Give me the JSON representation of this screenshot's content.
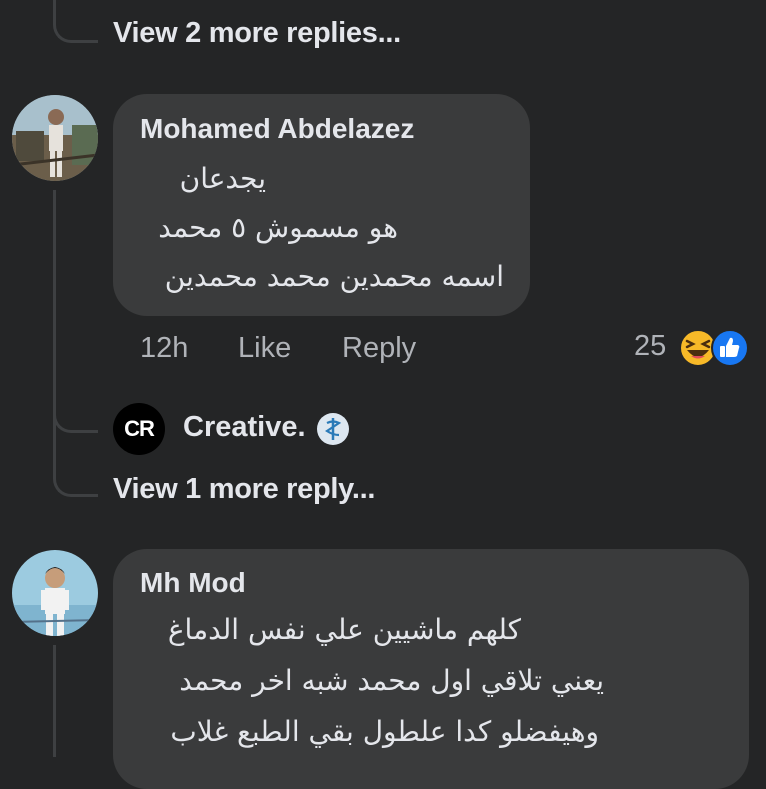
{
  "thread_top": {
    "more_replies": "View 2 more replies..."
  },
  "comment1": {
    "author": "Mohamed Abdelazez",
    "lines": [
      "يجدعان",
      "هو مسموش ٥ محمد",
      "اسمه محمدين محمد محمدين"
    ],
    "time": "12h",
    "like_label": "Like",
    "reply_label": "Reply",
    "reaction_count": "25",
    "reactions": [
      "haha-icon",
      "like-icon"
    ],
    "colors": {
      "like": "#1877f2",
      "haha": "#f7b928"
    }
  },
  "reply_preview": {
    "author": "Creative.",
    "logo_text": "CR",
    "badge": "medical-badge-icon"
  },
  "thread_mid": {
    "more_replies": "View 1 more reply..."
  },
  "comment2": {
    "author": "Mh Mod",
    "lines": [
      "كلهم ماشيين علي نفس الدماغ",
      "يعني تلاقي اول محمد شبه اخر محمد",
      "وهيفضلو كدا علطول بقي الطبع غلاب"
    ]
  }
}
